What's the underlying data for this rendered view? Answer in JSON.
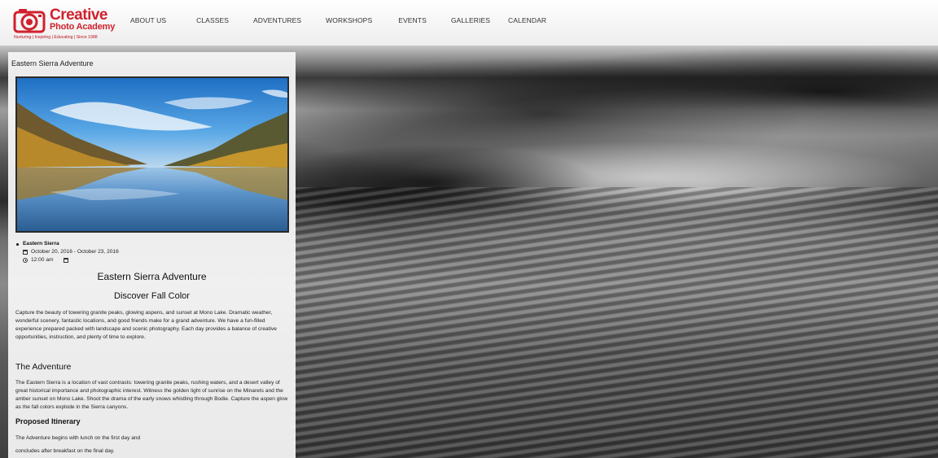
{
  "header": {
    "logo": {
      "name_line1": "Creative",
      "name_line2": "Photo Academy",
      "tagline": "Nurturing  |  Inspiring  |  Educating  |  Since 1988",
      "brand_color": "#d0212d",
      "icon": "camera-icon"
    },
    "nav": [
      {
        "label": "ABOUT US"
      },
      {
        "label": "CLASSES"
      },
      {
        "label": "ADVENTURES"
      },
      {
        "label": "WORKSHOPS"
      },
      {
        "label": "EVENTS"
      },
      {
        "label": "GALLERIES"
      },
      {
        "label": "CALENDAR"
      }
    ]
  },
  "panel": {
    "title": "Eastern Sierra Adventure",
    "event": {
      "location": "Eastern Sierra",
      "dates": "October 20, 2016 - October 23, 2016",
      "time": "12:00 am"
    },
    "heading": "Eastern Sierra Adventure",
    "subheading": "Discover Fall Color",
    "intro": "Capture the beauty of towering granite peaks, glowing aspens, and sunset at Mono Lake. Dramatic weather, wonderful scenery, fantastic locations, and good friends make for a grand adventure. We have a fun-filled experience prepared packed with landscape and scenic photography. Each day provides a balance of creative opportunities, instruction, and plenty of time to explore.",
    "adventure_heading": "The Adventure",
    "adventure_text": "The Eastern Sierra is a location of vast contrasts: towering granite peaks, rushing waters, and a desert valley of great historical importance and photographic interest. Witness the golden light of sunrise on the Minarets and the amber sunset on Mono Lake. Shoot the drama of the early snows whistling through Bodie. Capture the aspen glow as the fall colors explode in the Sierra canyons.",
    "itinerary_heading": "Proposed Itinerary",
    "itinerary_line1": "The Adventure begins with lunch on the first day and",
    "itinerary_line2": "concludes after breakfast on the final day."
  }
}
